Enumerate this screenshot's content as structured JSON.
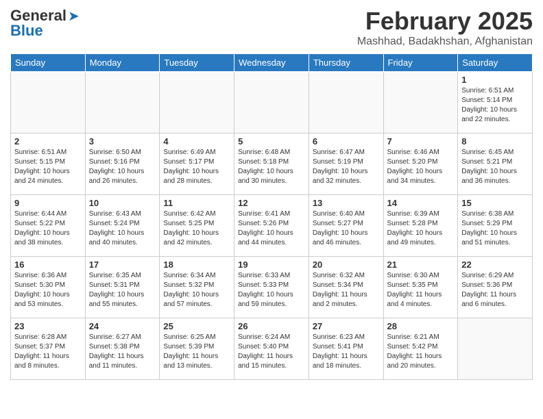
{
  "header": {
    "logo_general": "General",
    "logo_blue": "Blue",
    "month_year": "February 2025",
    "location": "Mashhad, Badakhshan, Afghanistan"
  },
  "days_of_week": [
    "Sunday",
    "Monday",
    "Tuesday",
    "Wednesday",
    "Thursday",
    "Friday",
    "Saturday"
  ],
  "weeks": [
    [
      {
        "day": "",
        "info": ""
      },
      {
        "day": "",
        "info": ""
      },
      {
        "day": "",
        "info": ""
      },
      {
        "day": "",
        "info": ""
      },
      {
        "day": "",
        "info": ""
      },
      {
        "day": "",
        "info": ""
      },
      {
        "day": "1",
        "info": "Sunrise: 6:51 AM\nSunset: 5:14 PM\nDaylight: 10 hours and 22 minutes."
      }
    ],
    [
      {
        "day": "2",
        "info": "Sunrise: 6:51 AM\nSunset: 5:15 PM\nDaylight: 10 hours and 24 minutes."
      },
      {
        "day": "3",
        "info": "Sunrise: 6:50 AM\nSunset: 5:16 PM\nDaylight: 10 hours and 26 minutes."
      },
      {
        "day": "4",
        "info": "Sunrise: 6:49 AM\nSunset: 5:17 PM\nDaylight: 10 hours and 28 minutes."
      },
      {
        "day": "5",
        "info": "Sunrise: 6:48 AM\nSunset: 5:18 PM\nDaylight: 10 hours and 30 minutes."
      },
      {
        "day": "6",
        "info": "Sunrise: 6:47 AM\nSunset: 5:19 PM\nDaylight: 10 hours and 32 minutes."
      },
      {
        "day": "7",
        "info": "Sunrise: 6:46 AM\nSunset: 5:20 PM\nDaylight: 10 hours and 34 minutes."
      },
      {
        "day": "8",
        "info": "Sunrise: 6:45 AM\nSunset: 5:21 PM\nDaylight: 10 hours and 36 minutes."
      }
    ],
    [
      {
        "day": "9",
        "info": "Sunrise: 6:44 AM\nSunset: 5:22 PM\nDaylight: 10 hours and 38 minutes."
      },
      {
        "day": "10",
        "info": "Sunrise: 6:43 AM\nSunset: 5:24 PM\nDaylight: 10 hours and 40 minutes."
      },
      {
        "day": "11",
        "info": "Sunrise: 6:42 AM\nSunset: 5:25 PM\nDaylight: 10 hours and 42 minutes."
      },
      {
        "day": "12",
        "info": "Sunrise: 6:41 AM\nSunset: 5:26 PM\nDaylight: 10 hours and 44 minutes."
      },
      {
        "day": "13",
        "info": "Sunrise: 6:40 AM\nSunset: 5:27 PM\nDaylight: 10 hours and 46 minutes."
      },
      {
        "day": "14",
        "info": "Sunrise: 6:39 AM\nSunset: 5:28 PM\nDaylight: 10 hours and 49 minutes."
      },
      {
        "day": "15",
        "info": "Sunrise: 6:38 AM\nSunset: 5:29 PM\nDaylight: 10 hours and 51 minutes."
      }
    ],
    [
      {
        "day": "16",
        "info": "Sunrise: 6:36 AM\nSunset: 5:30 PM\nDaylight: 10 hours and 53 minutes."
      },
      {
        "day": "17",
        "info": "Sunrise: 6:35 AM\nSunset: 5:31 PM\nDaylight: 10 hours and 55 minutes."
      },
      {
        "day": "18",
        "info": "Sunrise: 6:34 AM\nSunset: 5:32 PM\nDaylight: 10 hours and 57 minutes."
      },
      {
        "day": "19",
        "info": "Sunrise: 6:33 AM\nSunset: 5:33 PM\nDaylight: 10 hours and 59 minutes."
      },
      {
        "day": "20",
        "info": "Sunrise: 6:32 AM\nSunset: 5:34 PM\nDaylight: 11 hours and 2 minutes."
      },
      {
        "day": "21",
        "info": "Sunrise: 6:30 AM\nSunset: 5:35 PM\nDaylight: 11 hours and 4 minutes."
      },
      {
        "day": "22",
        "info": "Sunrise: 6:29 AM\nSunset: 5:36 PM\nDaylight: 11 hours and 6 minutes."
      }
    ],
    [
      {
        "day": "23",
        "info": "Sunrise: 6:28 AM\nSunset: 5:37 PM\nDaylight: 11 hours and 8 minutes."
      },
      {
        "day": "24",
        "info": "Sunrise: 6:27 AM\nSunset: 5:38 PM\nDaylight: 11 hours and 11 minutes."
      },
      {
        "day": "25",
        "info": "Sunrise: 6:25 AM\nSunset: 5:39 PM\nDaylight: 11 hours and 13 minutes."
      },
      {
        "day": "26",
        "info": "Sunrise: 6:24 AM\nSunset: 5:40 PM\nDaylight: 11 hours and 15 minutes."
      },
      {
        "day": "27",
        "info": "Sunrise: 6:23 AM\nSunset: 5:41 PM\nDaylight: 11 hours and 18 minutes."
      },
      {
        "day": "28",
        "info": "Sunrise: 6:21 AM\nSunset: 5:42 PM\nDaylight: 11 hours and 20 minutes."
      },
      {
        "day": "",
        "info": ""
      }
    ]
  ]
}
